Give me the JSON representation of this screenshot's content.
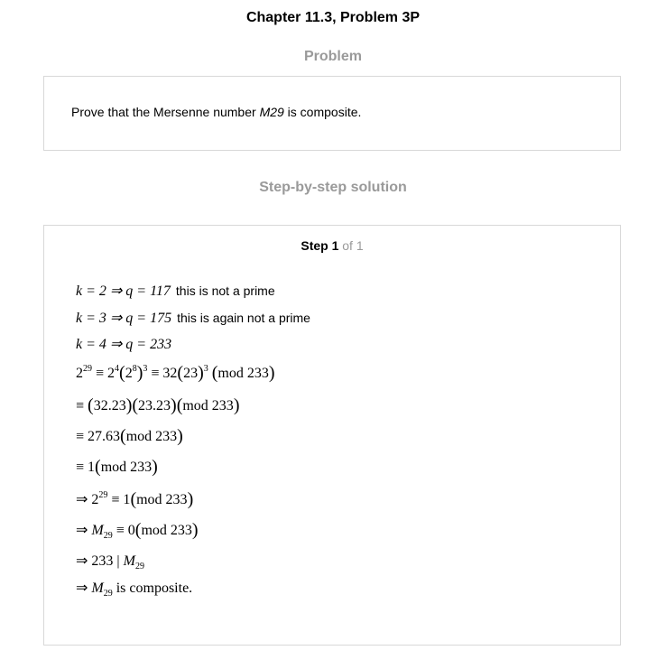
{
  "header": {
    "title": "Chapter 11.3, Problem 3P",
    "problem_heading": "Problem",
    "solution_heading": "Step-by-step solution"
  },
  "problem": {
    "text_before": "Prove that the Mersenne number ",
    "term": "M29",
    "text_after": " is composite."
  },
  "step": {
    "label": "Step 1",
    "of": " of 1"
  },
  "solution": {
    "k2": {
      "lhs": "k = 2 ⇒ q = 117",
      "note": "this is not a prime"
    },
    "k3": {
      "lhs": "k = 3 ⇒ q = 175",
      "note": "this is again not a prime"
    },
    "k4": {
      "lhs": "k = 4 ⇒ q = 233"
    },
    "l4": {
      "b1": "2",
      "e1": "29",
      "m1": " ≡ 2",
      "e2": "4",
      "m2": "2",
      "e3": "8",
      "e4": "3",
      "m3": " ≡ 32",
      "m4": "23",
      "e5": "3",
      "m5": "mod 233"
    },
    "l5": {
      "a": "≡ ",
      "b": "32.23",
      "c": "23.23",
      "d": "mod 233"
    },
    "l6": {
      "a": "≡ 27.63",
      "b": "mod 233"
    },
    "l7": {
      "a": "≡ 1",
      "b": "mod 233"
    },
    "l8": {
      "a": "⇒ 2",
      "e": "29",
      "b": " ≡ 1",
      "c": "mod 233"
    },
    "l9": {
      "a": "⇒ ",
      "m": "M",
      "s": "29",
      "b": " ≡ 0",
      "c": "mod 233"
    },
    "l10": {
      "a": "⇒ 233 | ",
      "m": "M",
      "s": "29"
    },
    "l11": {
      "a": "⇒ ",
      "m": "M",
      "s": "29",
      "b": "  is composite."
    }
  }
}
